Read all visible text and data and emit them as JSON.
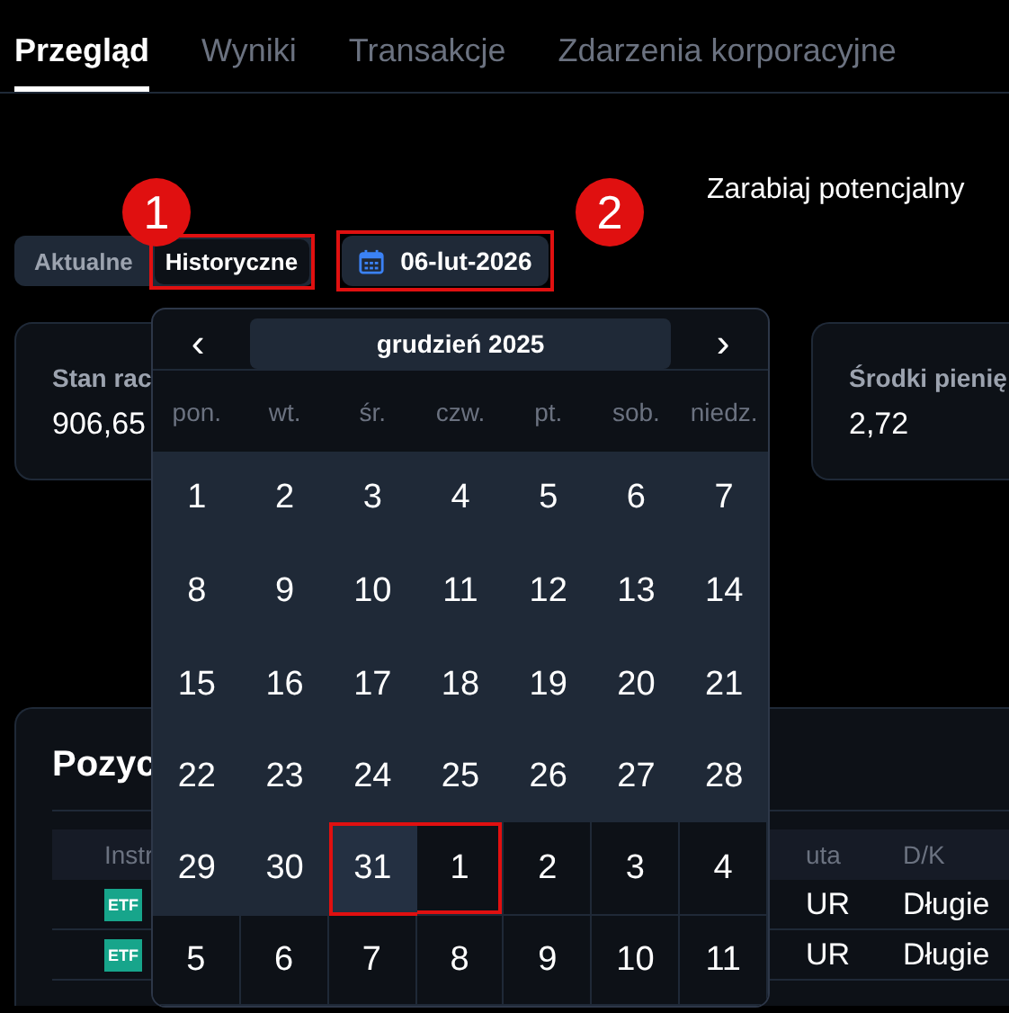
{
  "tabs": [
    {
      "label": "Przegląd",
      "selected": true
    },
    {
      "label": "Wyniki",
      "selected": false
    },
    {
      "label": "Transakcje",
      "selected": false
    },
    {
      "label": "Zdarzenia korporacyjne",
      "selected": false
    }
  ],
  "promo": "Zarabiaj potencjalny",
  "mode_toggle": [
    {
      "label": "Aktualne",
      "selected": false,
      "highlighted": false
    },
    {
      "label": "Historyczne",
      "selected": true,
      "highlighted": true
    }
  ],
  "date_button": {
    "label": "06-lut-2026",
    "highlighted": true
  },
  "cards": [
    {
      "label": "Stan rac",
      "value": "906,65"
    },
    {
      "label": "Środki pienię",
      "value": "2,72"
    }
  ],
  "positions": {
    "title": "Pozyc",
    "columns": [
      "Instr",
      "uta",
      "D/K"
    ],
    "rows": [
      {
        "badge": "ETF",
        "column_2": "UR",
        "column_3": "Długie"
      },
      {
        "badge": "ETF",
        "column_2": "UR",
        "column_3": "Długie"
      }
    ]
  },
  "calendar": {
    "prev": "‹",
    "next": "›",
    "month": "grudzień 2025",
    "weekdays": [
      "pon.",
      "wt.",
      "śr.",
      "czw.",
      "pt.",
      "sob.",
      "niedz."
    ],
    "days": [
      {
        "label": "1",
        "kind": "current",
        "highlighted": false
      },
      {
        "label": "2",
        "kind": "current",
        "highlighted": false
      },
      {
        "label": "3",
        "kind": "current",
        "highlighted": false
      },
      {
        "label": "4",
        "kind": "current",
        "highlighted": false
      },
      {
        "label": "5",
        "kind": "current",
        "highlighted": false
      },
      {
        "label": "6",
        "kind": "current",
        "highlighted": false
      },
      {
        "label": "7",
        "kind": "current",
        "highlighted": false
      },
      {
        "label": "8",
        "kind": "current",
        "highlighted": false
      },
      {
        "label": "9",
        "kind": "current",
        "highlighted": false
      },
      {
        "label": "10",
        "kind": "current",
        "highlighted": false
      },
      {
        "label": "11",
        "kind": "current",
        "highlighted": false
      },
      {
        "label": "12",
        "kind": "current",
        "highlighted": false
      },
      {
        "label": "13",
        "kind": "current",
        "highlighted": false
      },
      {
        "label": "14",
        "kind": "current",
        "highlighted": false
      },
      {
        "label": "15",
        "kind": "current",
        "highlighted": false
      },
      {
        "label": "16",
        "kind": "current",
        "highlighted": false
      },
      {
        "label": "17",
        "kind": "current",
        "highlighted": false
      },
      {
        "label": "18",
        "kind": "current",
        "highlighted": false
      },
      {
        "label": "19",
        "kind": "current",
        "highlighted": false
      },
      {
        "label": "20",
        "kind": "current",
        "highlighted": false
      },
      {
        "label": "21",
        "kind": "current",
        "highlighted": false
      },
      {
        "label": "22",
        "kind": "current",
        "highlighted": false
      },
      {
        "label": "23",
        "kind": "current",
        "highlighted": false
      },
      {
        "label": "24",
        "kind": "current",
        "highlighted": false
      },
      {
        "label": "25",
        "kind": "current",
        "highlighted": false
      },
      {
        "label": "26",
        "kind": "current",
        "highlighted": false
      },
      {
        "label": "27",
        "kind": "current",
        "highlighted": false
      },
      {
        "label": "28",
        "kind": "current",
        "highlighted": false
      },
      {
        "label": "29",
        "kind": "current",
        "highlighted": false
      },
      {
        "label": "30",
        "kind": "current",
        "highlighted": false
      },
      {
        "label": "31",
        "kind": "hovered",
        "highlighted": true
      },
      {
        "label": "1",
        "kind": "next",
        "highlighted": true
      },
      {
        "label": "2",
        "kind": "next",
        "highlighted": false
      },
      {
        "label": "3",
        "kind": "next",
        "highlighted": false
      },
      {
        "label": "4",
        "kind": "next",
        "highlighted": false
      },
      {
        "label": "5",
        "kind": "next",
        "highlighted": false
      },
      {
        "label": "6",
        "kind": "next",
        "highlighted": false
      },
      {
        "label": "7",
        "kind": "next",
        "highlighted": false
      },
      {
        "label": "8",
        "kind": "next",
        "highlighted": false
      },
      {
        "label": "9",
        "kind": "next",
        "highlighted": false
      },
      {
        "label": "10",
        "kind": "next",
        "highlighted": false
      },
      {
        "label": "11",
        "kind": "next",
        "highlighted": false
      }
    ]
  },
  "markers": [
    {
      "number": "1"
    },
    {
      "number": "2"
    }
  ]
}
